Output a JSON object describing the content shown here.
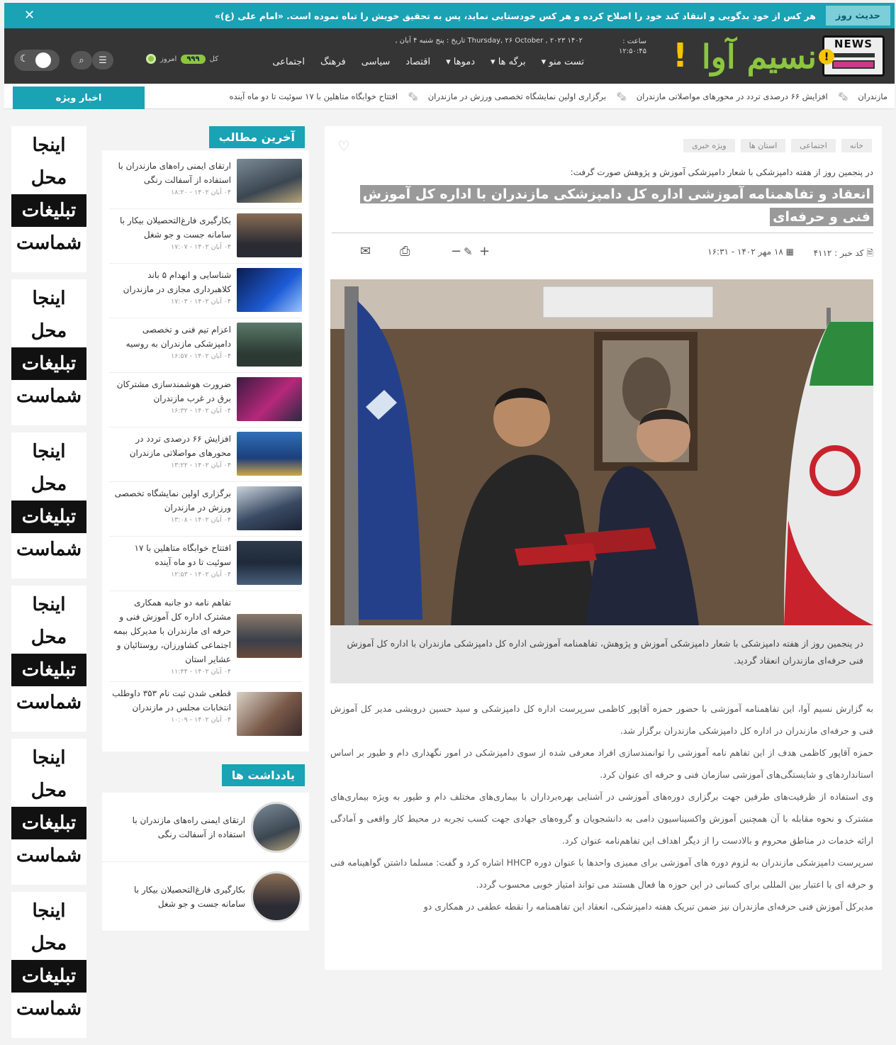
{
  "hadith": {
    "label": "حدیث روز",
    "text": "هر کس از خود بدگویی و انتقاد کند خود را اصلاح کرده و هر کس خودستایی نماید، پس به تحقیق خویش را تباه نموده است. «امام علی (ع)»",
    "close": "✕"
  },
  "header": {
    "logo_badge": "NEWS",
    "logo_wordmark": "نسیم آوا",
    "date": "Thursday, ۲۶ October , ۲۰۲۳   ۱۴۰۲ تاریخ : پنج شنبه ۴ آبان ,",
    "clock_label": "ساعت :",
    "clock_value": "۱۲:۵۰:۴۵",
    "menu": [
      "تست منو",
      "برگه ها",
      "دموها",
      "اقتصاد",
      "سیاسی",
      "فرهنگ",
      "اجتماعی"
    ],
    "counter_all_label": "کل",
    "counter_all_value": "۹۹۹",
    "counter_today_label": "امروز"
  },
  "ticker": {
    "label": "اخبار ویژه",
    "items": [
      "مازندران",
      "افزایش ۶۶ درصدی تردد در محورهای مواصلاتی مازندران",
      "برگزاری اولین نمایشگاه تخصصی ورزش در مازندران",
      "افتتاح خوابگاه متاهلین با ۱۷ سوئیت تا دو ماه آینده"
    ]
  },
  "ads": {
    "w1": "اینجا",
    "w2": "محل",
    "w3": "تبلیغات",
    "w4": "شماست"
  },
  "sidebar": {
    "latest_title": "آخرین مطالب",
    "latest": [
      {
        "title": "ارتقای ایمنی راه‌های مازندران با استفاده از آسفالت رنگی",
        "date": "۰۴ آبان ۱۴۰۲ - ۱۸:۲۰"
      },
      {
        "title": "بکارگیری فارغ‌التحصیلان بیکار با سامانه جست و جو شغل",
        "date": "۰۴ آبان ۱۴۰۲ - ۱۷:۰۷"
      },
      {
        "title": "شناسایی و انهدام ۵ باند کلاهبرداری مجازی در مازندران",
        "date": "۰۴ آبان ۱۴۰۲ - ۱۷:۰۳"
      },
      {
        "title": "اعزام تیم فنی و تخصصی دامپزشکی مازندران به روسیه",
        "date": "۰۴ آبان ۱۴۰۲ - ۱۶:۵۷"
      },
      {
        "title": "ضرورت هوشمندسازی مشترکان برق در غرب مازندران",
        "date": "۰۴ آبان ۱۴۰۲ - ۱۶:۳۲"
      },
      {
        "title": "افزایش ۶۶ درصدی تردد در محورهای مواصلاتی مازندران",
        "date": "۰۴ آبان ۱۴۰۲ - ۱۳:۲۲"
      },
      {
        "title": "برگزاری اولین نمایشگاه تخصصی ورزش در مازندران",
        "date": "۰۴ آبان ۱۴۰۲ - ۱۳:۰۸"
      },
      {
        "title": "افتتاح خوابگاه متاهلین با ۱۷ سوئیت تا دو ماه آینده",
        "date": "۰۴ آبان ۱۴۰۲ - ۱۲:۵۳"
      },
      {
        "title": "تفاهم نامه دو جانبه همکاری مشترک اداره کل آموزش فنی و حرفه ای مازندران با مدیرکل بیمه اجتماعی کشاورزان، روستائیان و عشایر استان",
        "date": "۰۴ آبان ۱۴۰۲ - ۱۱:۴۴"
      },
      {
        "title": "قطعی شدن ثبت نام ۳۵۳ داوطلب انتخابات مجلس در مازندران",
        "date": "۰۴ آبان ۱۴۰۲ - ۱۰:۰۹"
      }
    ],
    "notes_title": "یادداشت ها",
    "notes": [
      {
        "title": "ارتقای ایمنی راه‌های مازندران با استفاده از آسفالت رنگی"
      },
      {
        "title": "بکارگیری فارغ‌التحصیلان بیکار با سامانه جست و جو شغل"
      }
    ]
  },
  "article": {
    "crumbs": [
      "خانه",
      "اجتماعی",
      "استان ها",
      "ویژه خبری"
    ],
    "lead_small": "در پنجمین روز از هفته دامپزشکی با شعار دامپزشکی آموزش و پژوهش صورت گرفت:",
    "headline": "انعقاد و تفاهمنامه آموزشی اداره کل دامپزشکی مازندران با اداره کل آموزش فنی و حرفه‌ای",
    "code": "کد خبر : ۴۱۱۲",
    "pub_date": "۱۸ مهر ۱۴۰۲ - ۱۶:۳۱",
    "caption": "در پنجمین روز از هفته دامپزشکی با شعار دامپزشکی آموزش و پژوهش، تفاهمنامه آموزشی اداره کل دامپزشکی مازندران با اداره کل آموزش فنی حرفه‌ای مازندران انعقاد گردید.",
    "paragraphs": [
      "به گزارش نسیم آوا، این تفاهمنامه آموزشی با حضور حمزه آقاپور کاظمی سرپرست اداره کل دامپزشکی و سید حسین درویشی مدیر کل آموزش فنی و حرفه‌ای مازندران در اداره کل دامپزشکی مازندران برگزار شد.",
      "حمزه آقاپور کاظمی هدف از این تفاهم نامه آموزشی را توانمندسازی افراد معرفی شده از سوی دامپزشکی در امور نگهداری دام و طیور بر اساس استانداردهای و شایستگی‌های آموزشی سازمان فنی و حرفه ای عنوان کرد.",
      "وی استفاده از ظرفیت‌های طرفین جهت برگزاری دوره‌های آموزشی در آشنایی بهره‌برداران با بیماری‌های مختلف دام و طیور به ویژه بیماری‌های مشترک و نحوه مقابله با آن همچنین آموزش واکسیناسیون دامی به دانشجویان و گروه‌های جهادی جهت کسب تجربه در محیط کار واقعی و آمادگی ارائه خدمات در مناطق محروم و بالادست را از دیگر اهداف این تفاهم‌نامه عنوان کرد.",
      "سرپرست دامپزشکی مازندران به لزوم دوره های آموزشی برای ممیزی واحدها با عنوان دوره HHCP اشاره کرد و گفت: مسلما داشتن گواهینامه فنی و حرفه ای با اعتبار بین المللی برای کسانی در این حوزه ها فعال هستند می تواند امتیاز خوبی محسوب گردد.",
      "مدیرکل آموزش فنی حرفه‌ای مازندران نیز ضمن تبریک هفته دامپزشکی، انعقاد این تفاهمنامه را نقطه عطفی در همکاری دو"
    ]
  },
  "colors": {
    "accent": "#1aa2b5",
    "header_bg": "#353535",
    "brand_green": "#8cc63f",
    "brand_yellow": "#f7c400"
  }
}
